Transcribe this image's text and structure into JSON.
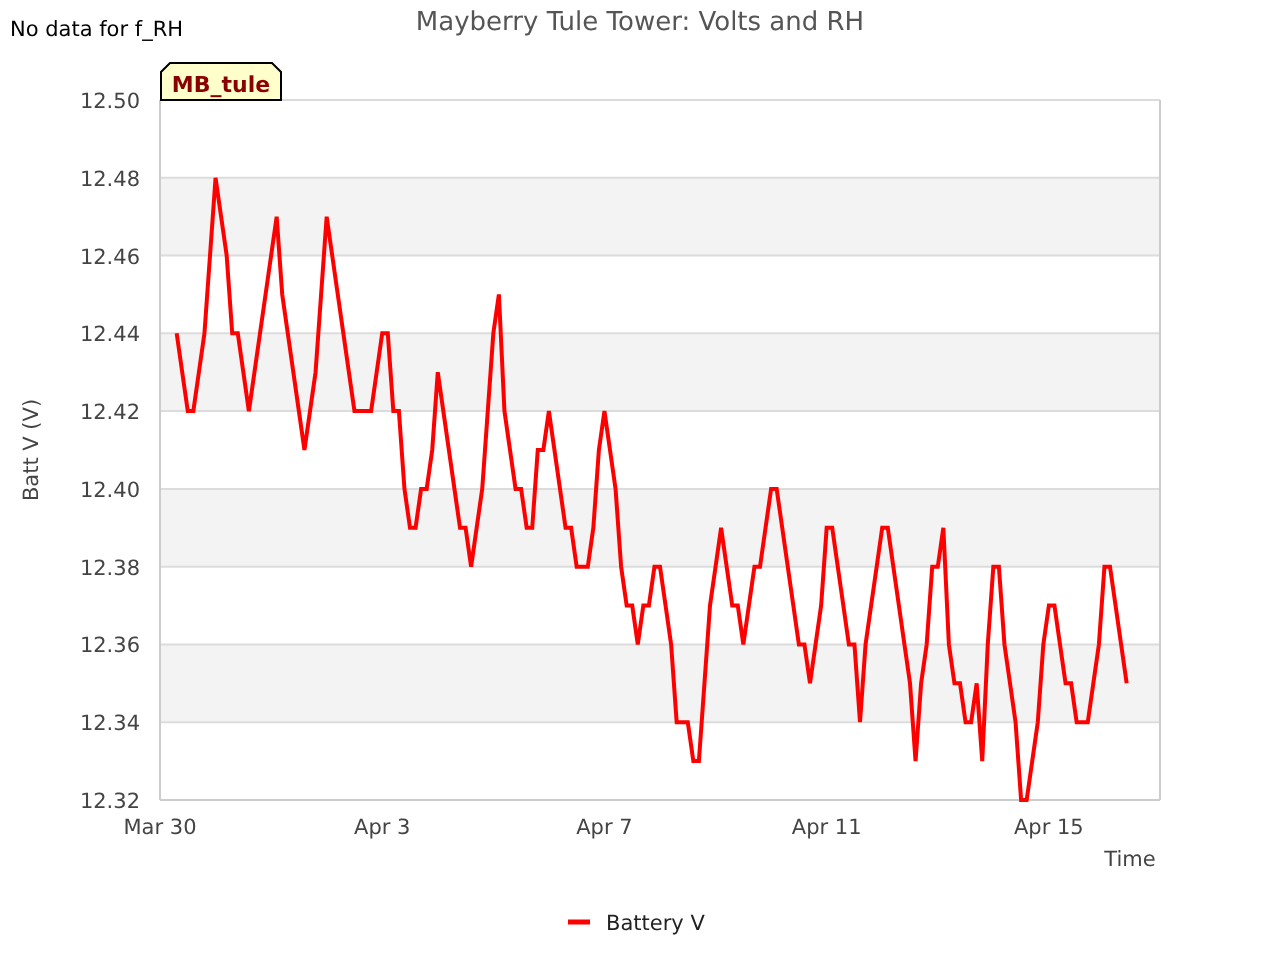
{
  "notice": "No data for f_RH",
  "chart": {
    "station_tag": "MB_tule",
    "chart_data": {
      "type": "line",
      "title": "Mayberry Tule Tower: Volts and RH",
      "xlabel": "Time",
      "ylabel": "Batt V (V)",
      "categories": [
        "Mar 30",
        null,
        null,
        null,
        null,
        null,
        null,
        null,
        null,
        null,
        null,
        null,
        null,
        null,
        null,
        null,
        null,
        null,
        null,
        null,
        null,
        null,
        null,
        null,
        null,
        null,
        null,
        null,
        null,
        null,
        null,
        null,
        null,
        null,
        null,
        null,
        null,
        null,
        null,
        null,
        "Apr 3",
        null,
        null,
        null,
        null,
        null,
        null,
        null,
        null,
        null,
        null,
        null,
        null,
        null,
        null,
        null,
        null,
        null,
        null,
        null,
        null,
        null,
        null,
        null,
        null,
        null,
        null,
        null,
        null,
        null,
        null,
        null,
        null,
        null,
        null,
        null,
        null,
        null,
        null,
        null,
        "Apr 7",
        null,
        null,
        null,
        null,
        null,
        null,
        null,
        null,
        null,
        null,
        null,
        null,
        null,
        null,
        null,
        null,
        null,
        null,
        null,
        null,
        null,
        null,
        null,
        null,
        null,
        null,
        null,
        null,
        null,
        null,
        null,
        null,
        null,
        null,
        null,
        null,
        null,
        null,
        null,
        "Apr 11",
        null,
        null,
        null,
        null,
        null,
        null,
        null,
        null,
        null,
        null,
        null,
        null,
        null,
        null,
        null,
        null,
        null,
        null,
        null,
        null,
        null,
        null,
        null,
        null,
        null,
        null,
        null,
        null,
        null,
        null,
        null,
        null,
        null,
        null,
        null,
        null,
        null,
        null,
        null,
        "Apr 15",
        null,
        null,
        null,
        null,
        null,
        null,
        null,
        null,
        null,
        null,
        null,
        null,
        null,
        null,
        null,
        null,
        null,
        null,
        null,
        null
      ],
      "series": [
        {
          "name": "Battery V",
          "color": "#ff0000",
          "values": [
            null,
            null,
            null,
            12.44,
            12.43,
            12.42,
            12.42,
            12.43,
            12.44,
            12.46,
            12.48,
            12.47,
            12.46,
            12.44,
            12.44,
            12.43,
            12.42,
            12.43,
            12.44,
            12.45,
            12.46,
            12.47,
            12.45,
            12.44,
            12.43,
            12.42,
            12.41,
            12.42,
            12.43,
            12.45,
            12.47,
            12.46,
            12.45,
            12.44,
            12.43,
            12.42,
            12.42,
            12.42,
            12.42,
            12.43,
            12.44,
            12.44,
            12.42,
            12.42,
            12.4,
            12.39,
            12.39,
            12.4,
            12.4,
            12.41,
            12.43,
            12.42,
            12.41,
            12.4,
            12.39,
            12.39,
            12.38,
            12.39,
            12.4,
            12.42,
            12.44,
            12.45,
            12.42,
            12.41,
            12.4,
            12.4,
            12.39,
            12.39,
            12.41,
            12.41,
            12.42,
            12.41,
            12.4,
            12.39,
            12.39,
            12.38,
            12.38,
            12.38,
            12.39,
            12.41,
            12.42,
            12.41,
            12.4,
            12.38,
            12.37,
            12.37,
            12.36,
            12.37,
            12.37,
            12.38,
            12.38,
            12.37,
            12.36,
            12.34,
            12.34,
            12.34,
            12.33,
            12.33,
            12.35,
            12.37,
            12.38,
            12.39,
            12.38,
            12.37,
            12.37,
            12.36,
            12.37,
            12.38,
            12.38,
            12.39,
            12.4,
            12.4,
            12.39,
            12.38,
            12.37,
            12.36,
            12.36,
            12.35,
            12.36,
            12.37,
            12.39,
            12.39,
            12.38,
            12.37,
            12.36,
            12.36,
            12.34,
            12.36,
            12.37,
            12.38,
            12.39,
            12.39,
            12.38,
            12.37,
            12.36,
            12.35,
            12.33,
            12.35,
            12.36,
            12.38,
            12.38,
            12.39,
            12.36,
            12.35,
            12.35,
            12.34,
            12.34,
            12.35,
            12.33,
            12.36,
            12.38,
            12.38,
            12.36,
            12.35,
            12.34,
            12.32,
            12.32,
            12.33,
            12.34,
            12.36,
            12.37,
            12.37,
            12.36,
            12.35,
            12.35,
            12.34,
            12.34,
            12.34,
            12.35,
            12.36,
            12.38,
            12.38,
            12.37,
            12.36,
            12.35,
            null,
            null,
            null,
            null,
            null,
            null
          ]
        }
      ],
      "grid": true,
      "ylim": [
        12.32,
        12.5
      ],
      "yticks": [
        {
          "value": 12.32,
          "label": "12.32"
        },
        {
          "value": 12.34,
          "label": "12.34"
        },
        {
          "value": 12.36,
          "label": "12.36"
        },
        {
          "value": 12.38,
          "label": "12.38"
        },
        {
          "value": 12.4,
          "label": "12.40"
        },
        {
          "value": 12.42,
          "label": "12.42"
        },
        {
          "value": 12.44,
          "label": "12.44"
        },
        {
          "value": 12.46,
          "label": "12.46"
        },
        {
          "value": 12.48,
          "label": "12.48"
        },
        {
          "value": 12.5,
          "label": "12.50"
        }
      ]
    }
  }
}
